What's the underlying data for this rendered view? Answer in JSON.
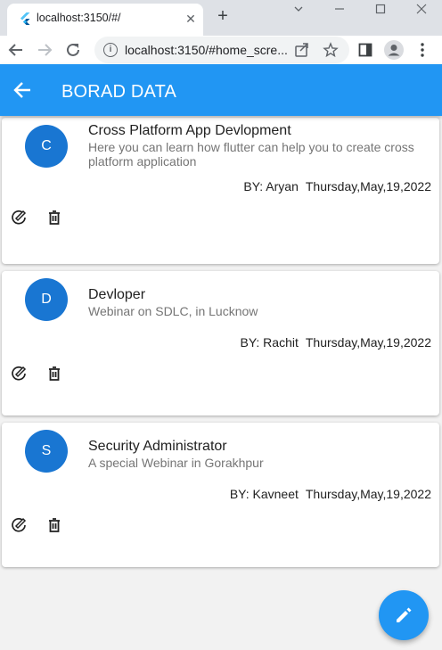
{
  "browser": {
    "tab_title": "localhost:3150/#/",
    "tab_close": "✕",
    "new_tab": "+",
    "url": "localhost:3150/#home_scre..."
  },
  "appbar": {
    "title": "BORAD DATA"
  },
  "cards": [
    {
      "avatar": "C",
      "title": "Cross Platform App Devlopment",
      "subtitle": "Here you can learn how flutter can help you to create cross platform application",
      "author": "BY: Aryan",
      "date": "Thursday,May,19,2022"
    },
    {
      "avatar": "D",
      "title": "Devloper",
      "subtitle": "Webinar on SDLC, in Lucknow",
      "author": "BY: Rachit",
      "date": "Thursday,May,19,2022"
    },
    {
      "avatar": "S",
      "title": "Security Administrator",
      "subtitle": "A special Webinar in Gorakhpur",
      "author": "BY: Kavneet",
      "date": "Thursday,May,19,2022"
    }
  ],
  "colors": {
    "primary": "#2196f3",
    "avatar": "#1976d2"
  }
}
